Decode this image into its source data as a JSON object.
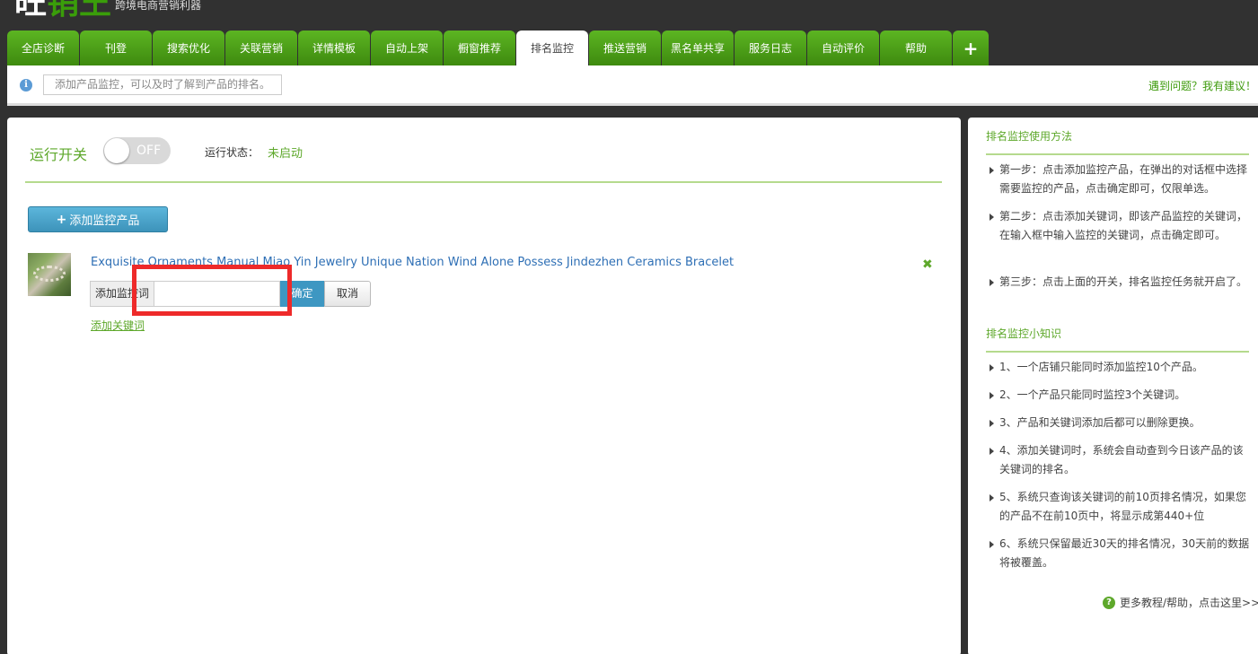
{
  "header": {
    "logo_left": "旺",
    "logo_right": "销王",
    "slogan": "跨境电商营销利器"
  },
  "tabs": [
    {
      "label": "全店诊断"
    },
    {
      "label": "刊登"
    },
    {
      "label": "搜索优化"
    },
    {
      "label": "关联营销"
    },
    {
      "label": "详情模板"
    },
    {
      "label": "自动上架"
    },
    {
      "label": "橱窗推荐"
    },
    {
      "label": "排名监控",
      "active": true
    },
    {
      "label": "推送营销"
    },
    {
      "label": "黑名单共享"
    },
    {
      "label": "服务日志"
    },
    {
      "label": "自动评价"
    },
    {
      "label": "帮助"
    },
    {
      "label": "+"
    }
  ],
  "infobar": {
    "icon": "info-icon",
    "message": "添加产品监控，可以及时了解到产品的排名。",
    "feedback": "遇到问题？我有建议！"
  },
  "main": {
    "run_switch_label": "运行开关",
    "toggle_text": "OFF",
    "toggle_on": false,
    "status_label": "运行状态：",
    "status_value": "未启动",
    "add_button": "添加监控产品",
    "product": {
      "title": "Exquisite Ornaments Manual Miao Yin Jewelry Unique Nation Wind Alone Possess Jindezhen Ceramics Bracelet",
      "keyword_label": "添加监控词",
      "keyword_value": "",
      "ok_button": "确定",
      "cancel_button": "取消",
      "add_keyword_link": "添加关键词"
    }
  },
  "side": {
    "usage_title": "排名监控使用方法",
    "steps": [
      "第一步：点击添加监控产品，在弹出的对话框中选择需要监控的产品，点击确定即可，仅限单选。",
      "第二步：点击添加关键词，即该产品监控的关键词，在输入框中输入监控的关键词，点击确定即可。",
      "第三步：点击上面的开关，排名监控任务就开启了。"
    ],
    "tips_title": "排名监控小知识",
    "tips": [
      "1、一个店铺只能同时添加监控10个产品。",
      "2、一个产品只能同时监控3个关键词。",
      "3、产品和关键词添加后都可以删除更换。",
      "4、添加关键词时，系统会自动查到今日该产品的该关键词的排名。",
      "5、系统只查询该关键词的前10页排名情况，如果您的产品不在前10页中，将显示成第440+位",
      "6、系统只保留最近30天的排名情况，30天前的数据将被覆盖。"
    ],
    "more_link": "更多教程/帮助，点击这里>>"
  },
  "colors": {
    "accent_green": "#5ea82b",
    "tab_green": "#4e9d17",
    "link_blue": "#2e6fb5",
    "button_blue": "#4aa3c8",
    "highlight_red": "#ee2a2a"
  }
}
